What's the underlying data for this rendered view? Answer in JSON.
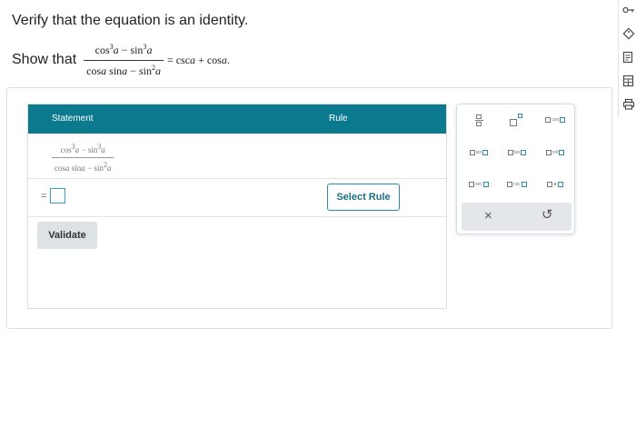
{
  "problem": {
    "title": "Verify that the equation is an identity.",
    "show_label": "Show that"
  },
  "table": {
    "headers": [
      "Statement",
      "Rule"
    ],
    "select_rule_label": "Select Rule",
    "equals": "="
  },
  "validate_label": "Validate",
  "keypad": {
    "functions": [
      "sin",
      "tan",
      "cot",
      "sec",
      "csc",
      "cos"
    ],
    "clear_symbol": "×",
    "undo_symbol": "↺"
  },
  "rail_icons": [
    "key-icon",
    "tag-icon",
    "document-icon",
    "calculator-icon",
    "print-icon"
  ]
}
